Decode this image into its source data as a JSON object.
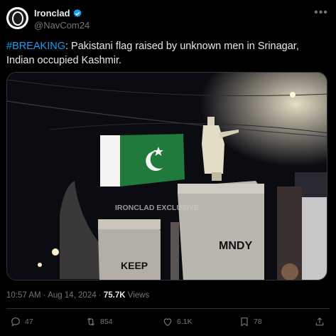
{
  "tweet": {
    "author_name": "Ironclad",
    "handle": "@NavCom24",
    "hashtag": "#BREAKING",
    "text": ": Pakistani flag raised by unknown men in Srinagar, Indian occupied Kashmir.",
    "media": {
      "watermark": "IRONCLAD EXCLUSIVE",
      "wall_text_1": "KEEP",
      "wall_text_2": "MNDY"
    },
    "time": "10:57 AM",
    "sep": " · ",
    "date": "Aug 14, 2024",
    "views_count": "75.7K",
    "views_label": " Views",
    "actions": {
      "reply_count": "47",
      "repost_count": "854",
      "like_count": "6.1K",
      "bookmark_count": "78"
    }
  },
  "colors": {
    "accent": "#1d9bf0",
    "muted": "#71767b",
    "flag_green": "#1f7a3c"
  },
  "icons": [
    "verified-badge-icon",
    "more-icon",
    "reply-icon",
    "repost-icon",
    "like-icon",
    "bookmark-icon",
    "share-icon"
  ]
}
